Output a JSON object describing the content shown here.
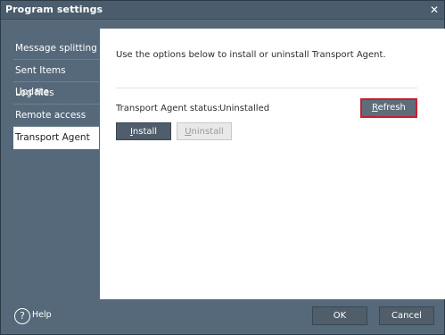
{
  "window": {
    "title": "Program settings",
    "close_label": "✕"
  },
  "sidebar": {
    "items": [
      {
        "label": "Message splitting"
      },
      {
        "label": "Sent Items Update"
      },
      {
        "label": "Log files"
      },
      {
        "label": "Remote access"
      },
      {
        "label": "Transport Agent",
        "active": true
      }
    ]
  },
  "panel": {
    "intro_text": "Use the options below to install or uninstall Transport Agent.",
    "status_label": "Transport Agent status:",
    "status_value": "Uninstalled",
    "refresh_label": "Refresh",
    "install_label": "Install",
    "uninstall_label": "Uninstall"
  },
  "footer": {
    "help_label": "Help",
    "ok_label": "OK",
    "cancel_label": "Cancel",
    "help_icon": "question-mark-icon"
  },
  "colors": {
    "window_bg": "#55697a",
    "panel_bg": "#ffffff",
    "button_bg": "#4f5e6a",
    "highlight": "#c51f2d",
    "disabled_bg": "#e9e9e9"
  }
}
